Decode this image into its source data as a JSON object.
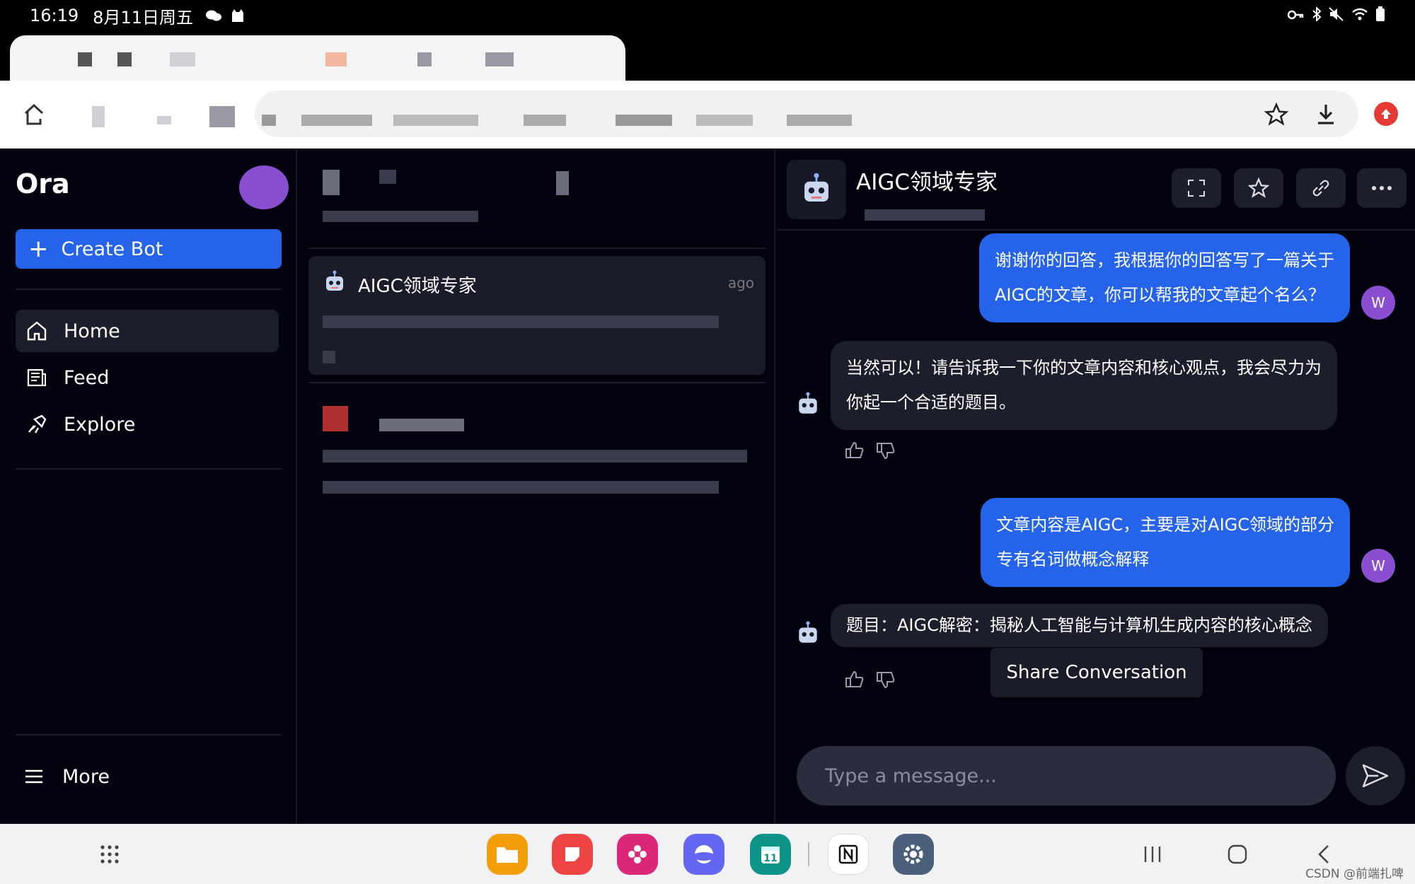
{
  "status_bar": {
    "time": "16:19",
    "date": "8月11日周五"
  },
  "app": {
    "brand": "Ora",
    "create_bot_label": "Create Bot",
    "nav": [
      {
        "label": "Home",
        "icon": "home-icon",
        "active": true
      },
      {
        "label": "Feed",
        "icon": "feed-icon",
        "active": false
      },
      {
        "label": "Explore",
        "icon": "explore-icon",
        "active": false
      }
    ],
    "more_label": "More"
  },
  "conversations": {
    "selected": {
      "title": "AIGC领域专家",
      "time": "ago"
    }
  },
  "chat": {
    "bot_name": "AIGC领域专家",
    "messages": [
      {
        "role": "user",
        "lines": [
          "谢谢你的回答，我根据你的回答写了一篇关于",
          "AIGC的文章，你可以帮我的文章起个名么？"
        ],
        "avatar": "W"
      },
      {
        "role": "bot",
        "lines": [
          "当然可以！请告诉我一下你的文章内容和核心观点，我会尽力为",
          "你起一个合适的题目。"
        ]
      },
      {
        "role": "user",
        "lines": [
          "文章内容是AIGC，主要是对AIGC领域的部分",
          "专有名词做概念解释"
        ],
        "avatar": "W"
      },
      {
        "role": "bot",
        "lines": [
          "题目：AIGC解密：揭秘人工智能与计算机生成内容的核心概念"
        ]
      }
    ],
    "tooltip": "Share Conversation",
    "composer_placeholder": "Type a message..."
  },
  "watermark": "CSDN @前端扎啤",
  "colors": {
    "accent": "#2563eb",
    "avatar": "#8a4fd1",
    "background": "#02030f",
    "bubble_bot": "#1c1e2c"
  }
}
